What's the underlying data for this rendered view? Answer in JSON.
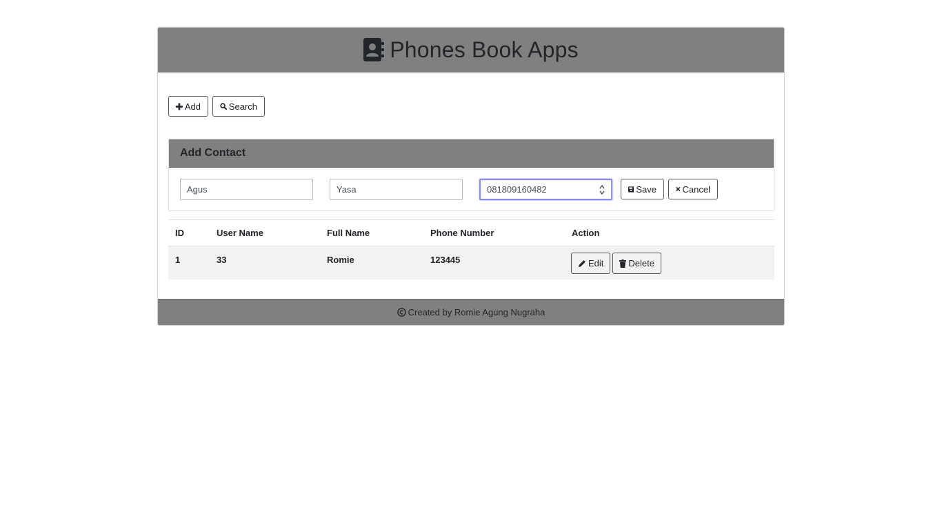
{
  "header": {
    "title": "Phones Book Apps",
    "icon": "address-book-icon"
  },
  "toolbar": {
    "add_label": "Add",
    "search_label": "Search"
  },
  "form": {
    "title": "Add Contact",
    "first_name": "Agus",
    "last_name": "Yasa",
    "phone": "081809160482",
    "save_label": "Save",
    "cancel_label": "Cancel"
  },
  "table": {
    "columns": [
      "ID",
      "User Name",
      "Full Name",
      "Phone Number",
      "Action"
    ],
    "rows": [
      {
        "id": "1",
        "user_name": "33",
        "full_name": "Romie",
        "phone": "123445",
        "edit_label": "Edit",
        "delete_label": "Delete"
      }
    ]
  },
  "footer": {
    "text": "Created by Romie Agung Nugraha",
    "icon": "copyright-icon"
  }
}
